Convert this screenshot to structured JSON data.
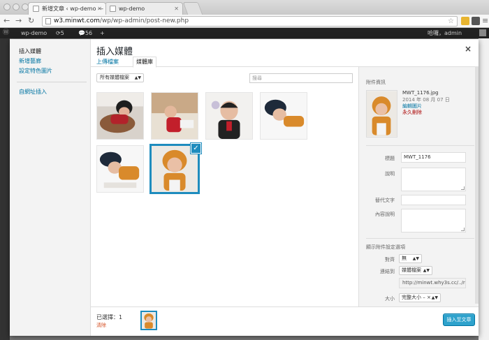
{
  "browser": {
    "tabs": [
      {
        "title": "新增文章 ‹ wp-demo — Wo",
        "active": true
      },
      {
        "title": "wp-demo",
        "active": false
      }
    ],
    "url_host": "w3.minwt.com",
    "url_path": "/wp/wp-admin/post-new.php"
  },
  "adminbar": {
    "site": "wp-demo",
    "updates": "5",
    "comments": "56",
    "new": "+",
    "greeting": "哈囉，admin"
  },
  "modal": {
    "menu": [
      {
        "label": "插入媒體",
        "active": true
      },
      {
        "label": "新增藝廊",
        "active": false
      },
      {
        "label": "設定特色圖片",
        "active": false
      },
      {
        "label": "自網址插入",
        "active": false
      }
    ],
    "title": "插入媒體",
    "close": "×",
    "router": [
      {
        "label": "上傳檔案",
        "active": false
      },
      {
        "label": "媒體庫",
        "active": true
      }
    ],
    "filter": "所有媒體檔案",
    "search_placeholder": "搜尋",
    "check_mark": "✓"
  },
  "attachment": {
    "heading": "附件資訊",
    "filename": "MWT_1176.jpg",
    "date": "2014 年 08 月 07 日",
    "edit_link": "編輯圖片",
    "delete_link": "永久刪除",
    "fields": {
      "title_label": "標題",
      "title_value": "MWT_1176",
      "caption_label": "說明",
      "alt_label": "替代文字",
      "description_label": "內容說明"
    }
  },
  "display_settings": {
    "heading": "顯示附件設定選項",
    "align_label": "對齊",
    "align_value": "無",
    "link_label": "連結到",
    "link_value": "媒體檔案",
    "link_url": "http://minwt.why3s.cc/../r",
    "size_label": "大小",
    "size_value": "完整大小 – ×"
  },
  "footer": {
    "selected": "已選擇：1",
    "clear": "清除",
    "insert_button": "插入至文章"
  },
  "colors": {
    "accent": "#1e8cbe",
    "primary_button": "#2ea2cc",
    "link": "#0074a2",
    "delete": "#aa0000"
  }
}
